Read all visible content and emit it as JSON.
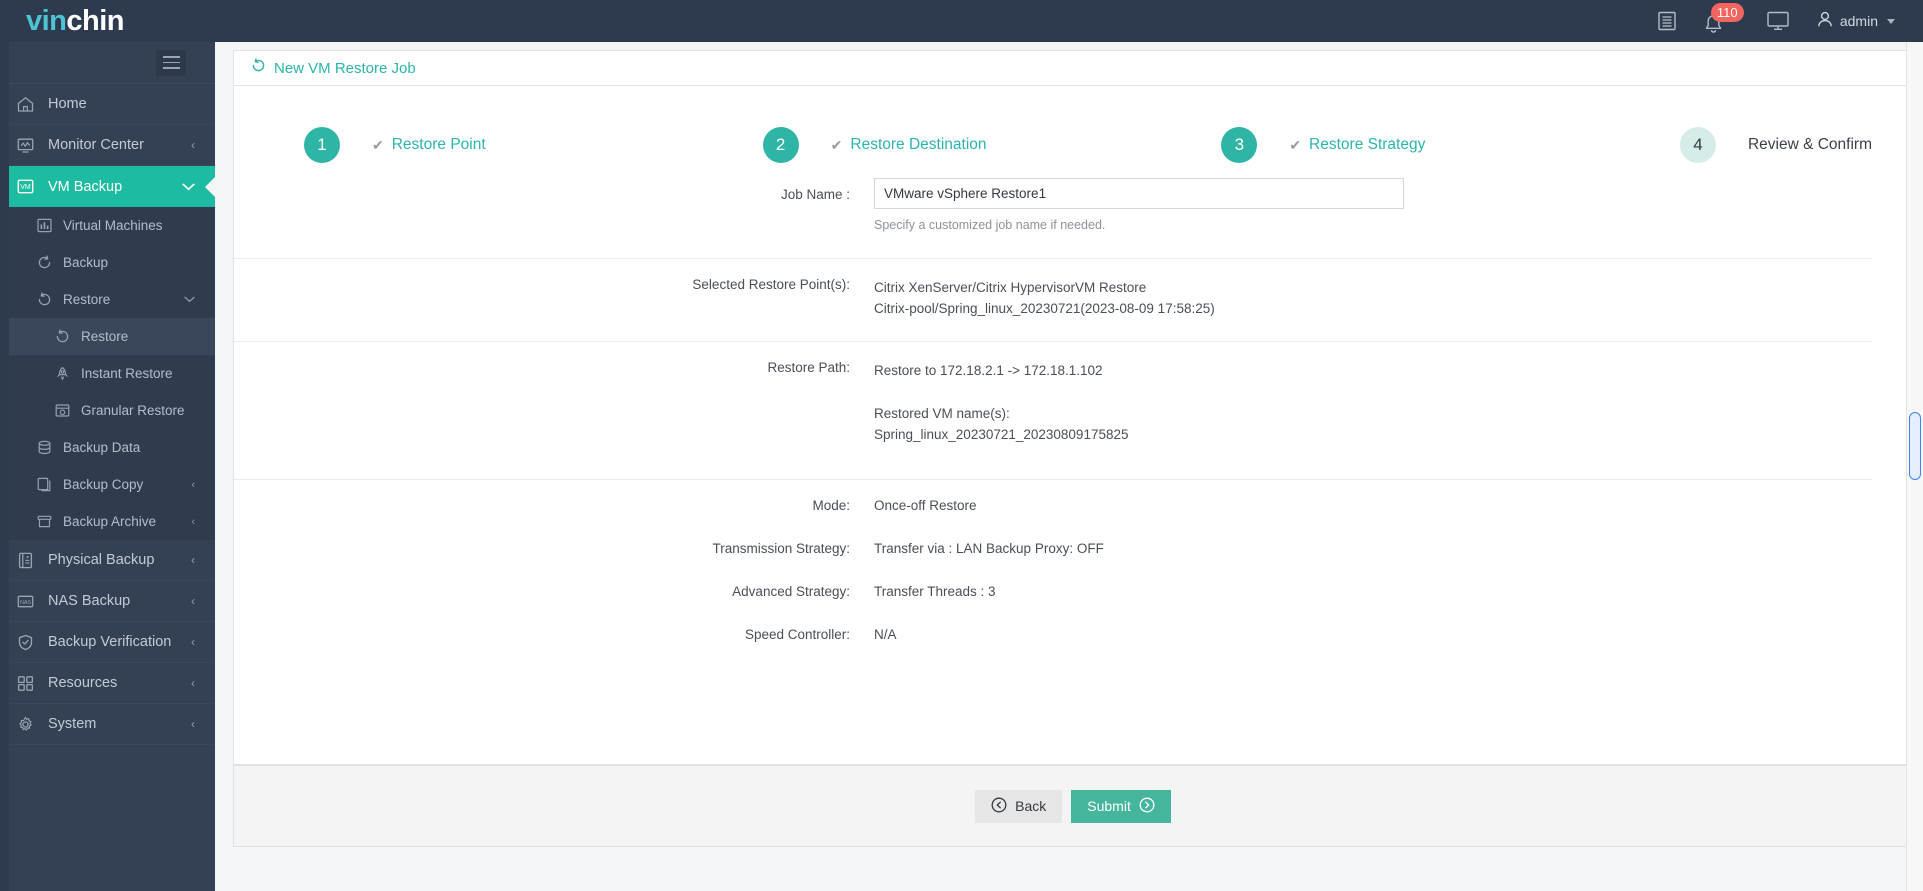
{
  "app": {
    "logo_first": "vin",
    "logo_second": "chin"
  },
  "topbar": {
    "notes_icon": "list-icon",
    "bell_icon": "bell-icon",
    "badge_count": "110",
    "monitor_icon": "monitor-icon",
    "user_icon": "user-icon",
    "user_name": "admin",
    "caret_icon": "chevron-down-icon",
    "accent": "#2eb5a5",
    "badge_color": "#f1645f",
    "bar_color": "#2e3b4e"
  },
  "sidebar": {
    "toggle_label": "menu-toggle",
    "items": [
      {
        "label": "Home",
        "icon": "home-icon",
        "chevron": "",
        "active": false
      },
      {
        "label": "Monitor Center",
        "icon": "monitor-chart-icon",
        "chevron": "‹",
        "active": false
      },
      {
        "label": "VM Backup",
        "icon": "vm-icon",
        "chevron": "∨",
        "active": true
      }
    ],
    "vm_children": [
      {
        "label": "Virtual Machines",
        "icon": "grid-chart-icon",
        "chevron": "",
        "indent": false,
        "selected": false
      },
      {
        "label": "Backup",
        "icon": "refresh-icon",
        "chevron": "",
        "indent": false,
        "selected": false
      },
      {
        "label": "Restore",
        "icon": "restore-icon",
        "chevron": "∨",
        "indent": false,
        "selected": false
      },
      {
        "label": "Restore",
        "icon": "restore-icon",
        "chevron": "",
        "indent": true,
        "selected": true
      },
      {
        "label": "Instant Restore",
        "icon": "rocket-icon",
        "chevron": "",
        "indent": true,
        "selected": false
      },
      {
        "label": "Granular Restore",
        "icon": "window-icon",
        "chevron": "",
        "indent": true,
        "selected": false
      },
      {
        "label": "Backup Data",
        "icon": "database-icon",
        "chevron": "",
        "indent": false,
        "selected": false
      },
      {
        "label": "Backup Copy",
        "icon": "copy-icon",
        "chevron": "‹",
        "indent": false,
        "selected": false
      },
      {
        "label": "Backup Archive",
        "icon": "archive-icon",
        "chevron": "‹",
        "indent": false,
        "selected": false
      }
    ],
    "bottom_items": [
      {
        "label": "Physical Backup",
        "icon": "server-icon",
        "chevron": "‹"
      },
      {
        "label": "NAS Backup",
        "icon": "nas-icon",
        "chevron": "‹"
      },
      {
        "label": "Backup Verification",
        "icon": "shield-check-icon",
        "chevron": "‹"
      },
      {
        "label": "Resources",
        "icon": "squares-icon",
        "chevron": "‹"
      },
      {
        "label": "System",
        "icon": "gear-icon",
        "chevron": "‹"
      }
    ]
  },
  "page": {
    "title": "New VM Restore Job",
    "title_icon": "restore-icon"
  },
  "stepper": {
    "steps": [
      {
        "number": "1",
        "label": "Restore Point",
        "done": true
      },
      {
        "number": "2",
        "label": "Restore Destination",
        "done": true
      },
      {
        "number": "3",
        "label": "Restore Strategy",
        "done": true
      },
      {
        "number": "4",
        "label": "Review & Confirm",
        "done": false
      }
    ],
    "check_glyph": "✔"
  },
  "form": {
    "job_name": {
      "label": "Job Name :",
      "value": "VMware vSphere Restore1",
      "placeholder": "Specify a customized job name",
      "hint": "Specify a customized job name if needed."
    },
    "restore_points": {
      "label": "Selected Restore Point(s):",
      "line1": "Citrix XenServer/Citrix HypervisorVM Restore",
      "line2": "Citrix-pool/Spring_linux_20230721(2023-08-09 17:58:25)"
    },
    "restore_path": {
      "label": "Restore Path:",
      "line1": "Restore to 172.18.2.1 -> 172.18.1.102",
      "line2": "Restored VM name(s):",
      "line3": "Spring_linux_20230721_20230809175825"
    },
    "mode": {
      "label": "Mode:",
      "value": "Once-off Restore"
    },
    "transmission": {
      "label": "Transmission Strategy:",
      "value": "Transfer via : LAN Backup Proxy: OFF"
    },
    "advanced": {
      "label": "Advanced Strategy:",
      "value": "Transfer Threads : 3"
    },
    "speed": {
      "label": "Speed Controller:",
      "value": "N/A"
    }
  },
  "footer": {
    "back_label": "Back",
    "back_icon": "arrow-left-circle-icon",
    "submit_label": "Submit",
    "submit_icon": "arrow-right-circle-icon"
  }
}
